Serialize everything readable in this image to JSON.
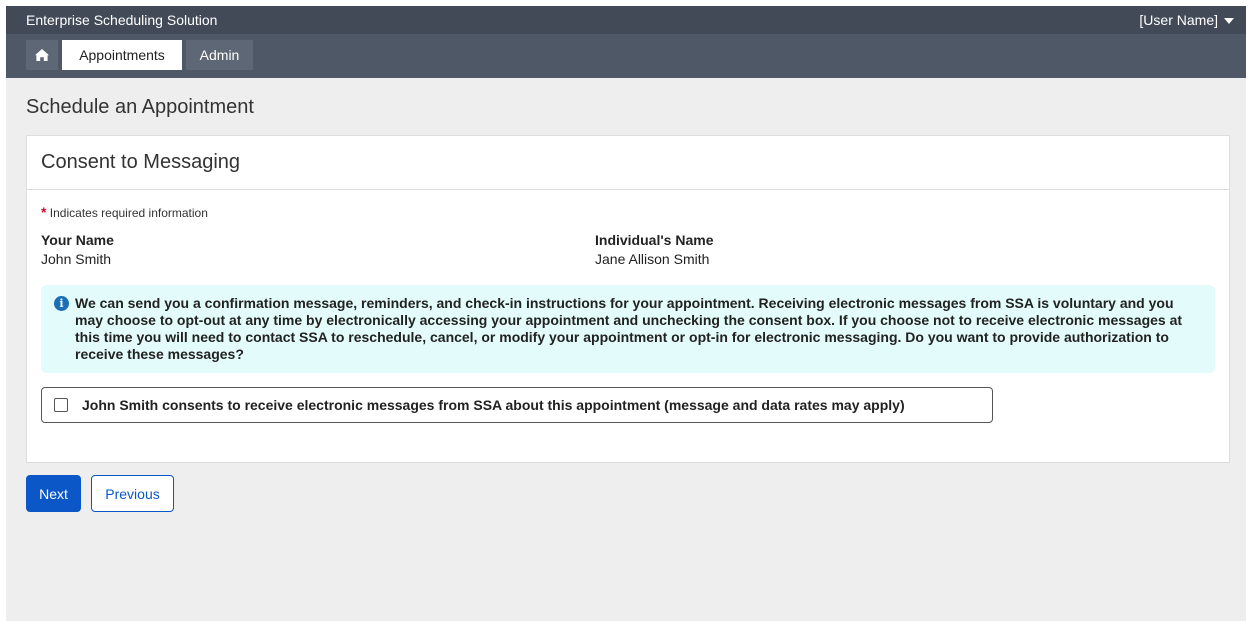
{
  "app": {
    "title": "Enterprise Scheduling Solution",
    "user_label": "[User Name]"
  },
  "nav": {
    "home_icon": "home-icon",
    "items": [
      {
        "label": "Appointments",
        "active": true
      },
      {
        "label": "Admin",
        "active": false
      }
    ]
  },
  "page": {
    "title": "Schedule an Appointment"
  },
  "panel": {
    "title": "Consent to Messaging",
    "required_star": "*",
    "required_note": "Indicates required information",
    "your_name_label": "Your Name",
    "your_name_value": "John Smith",
    "individual_name_label": "Individual's Name",
    "individual_name_value": "Jane Allison Smith",
    "info_icon": "info-icon",
    "info_text": "We can send you a confirmation message, reminders, and check-in instructions for your appointment. Receiving electronic messages from SSA is voluntary and you may choose to opt-out at any time by electronically accessing your appointment and unchecking the consent box. If you choose not to receive electronic messages at this time you will need to contact SSA to reschedule, cancel, or modify your appointment or opt-in for electronic messaging. Do you want to provide authorization to receive these messages?",
    "consent_label": "John Smith consents to receive electronic messages from SSA about this appointment (message and data rates may apply)",
    "consent_checked": false
  },
  "actions": {
    "next_label": "Next",
    "previous_label": "Previous"
  },
  "colors": {
    "topbar": "#414a56",
    "navbar": "#4e5866",
    "primary": "#0b57c8",
    "info_bg": "#e4fbfc",
    "required": "#c8102e"
  }
}
